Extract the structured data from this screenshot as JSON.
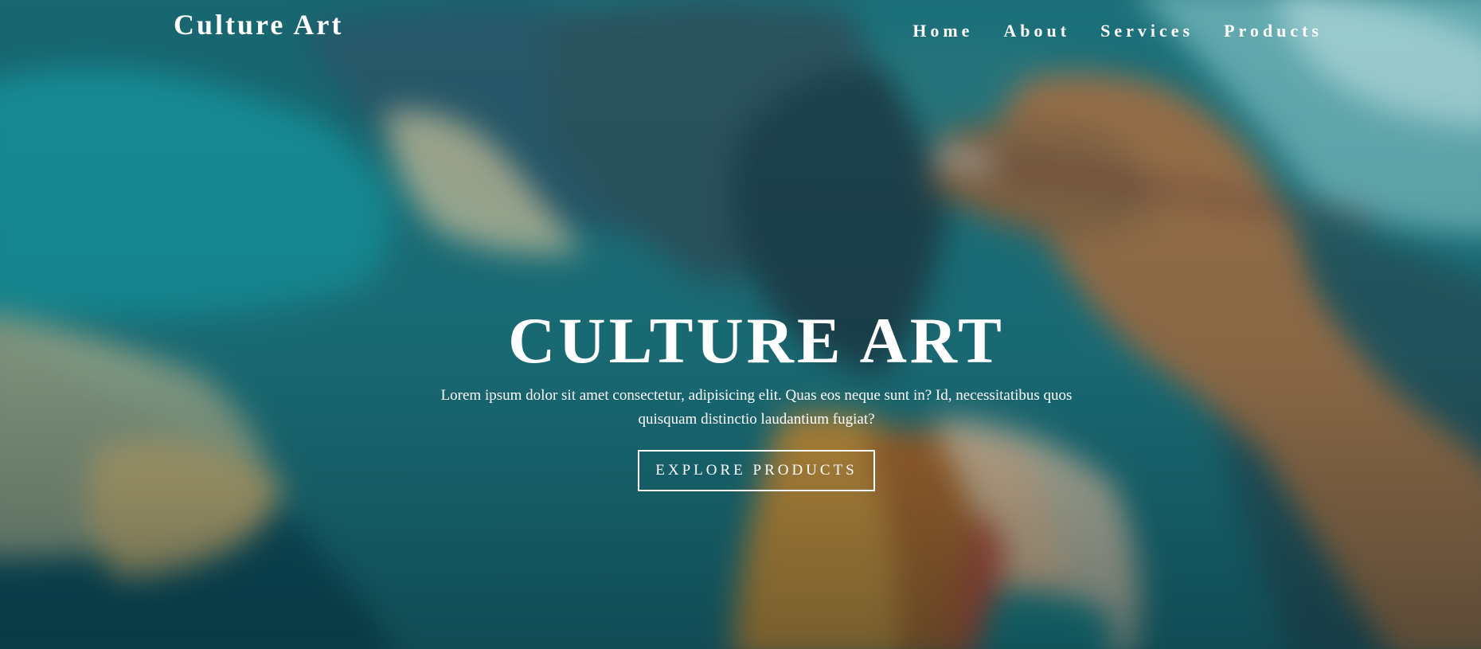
{
  "navbar": {
    "brand": "Culture Art",
    "links": [
      "Home",
      "About",
      "Services",
      "Products"
    ]
  },
  "hero": {
    "title": "CULTURE ART",
    "text": "Lorem ipsum dolor sit amet consectetur, adipisicing elit. Quas eos neque sunt in? Id, necessitatibus quos quisquam distinctio laudantium fugiat?",
    "button_label": "EXPLORE PRODUCTS"
  },
  "colors": {
    "text": "#ffffff",
    "background_teal": "#1f6f78",
    "button_border": "#ffffff"
  },
  "icons": {
    "background": "painting-brush-hand-image"
  }
}
